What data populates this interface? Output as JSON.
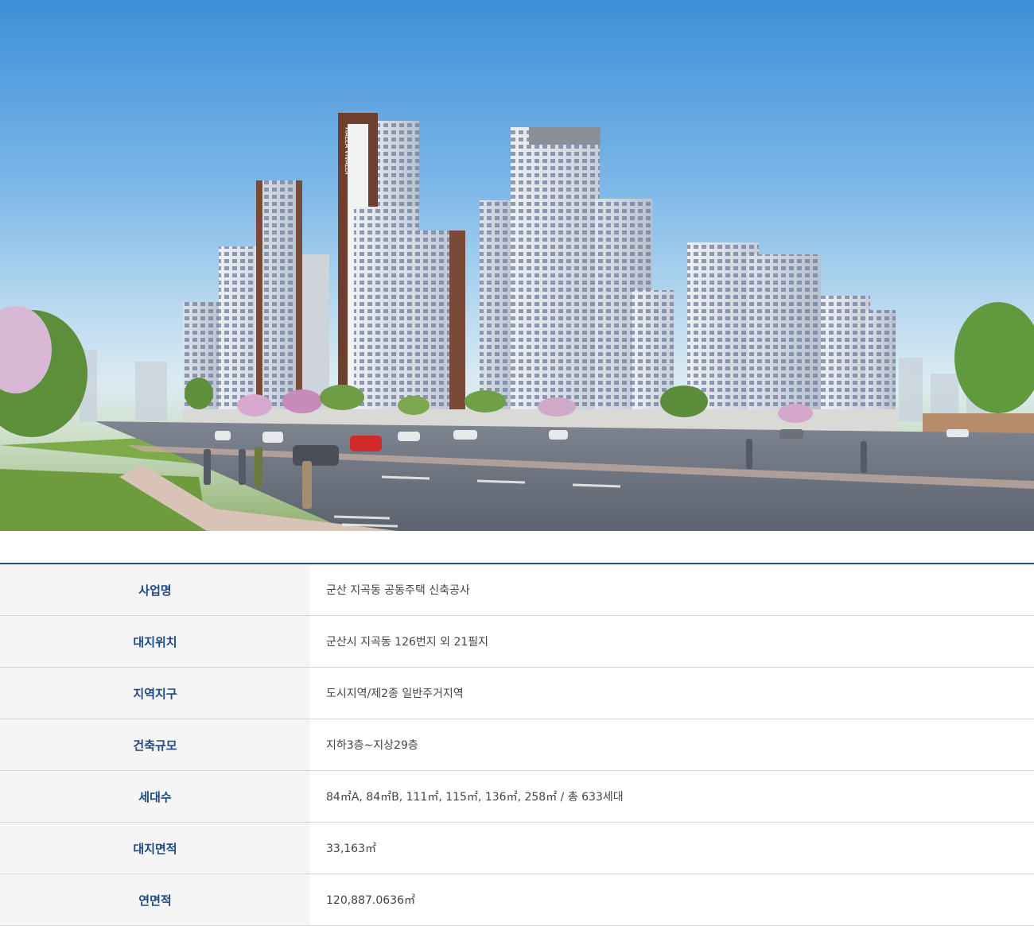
{
  "hero": {
    "image_name": "apartment-complex-rendering",
    "tower_sign": "HALLA VIVALDI"
  },
  "colors": {
    "header_text": "#1e4a86",
    "table_top_border": "#1f4e8a",
    "header_bg": "#f5f5f5",
    "body_text": "#444444"
  },
  "table": {
    "rows": [
      {
        "label": "사업명",
        "value": "군산 지곡동 공동주택 신축공사"
      },
      {
        "label": "대지위치",
        "value": "군산시 지곡동 126번지 외 21필지"
      },
      {
        "label": "지역지구",
        "value": "도시지역/제2종 일반주거지역"
      },
      {
        "label": "건축규모",
        "value": "지하3층~지상29층"
      },
      {
        "label": "세대수",
        "value": "84㎡A, 84㎡B, 111㎡, 115㎡, 136㎡, 258㎡ / 총 633세대"
      },
      {
        "label": "대지면적",
        "value": "33,163㎡"
      },
      {
        "label": "연면적",
        "value": "120,887.0636㎡"
      }
    ]
  }
}
